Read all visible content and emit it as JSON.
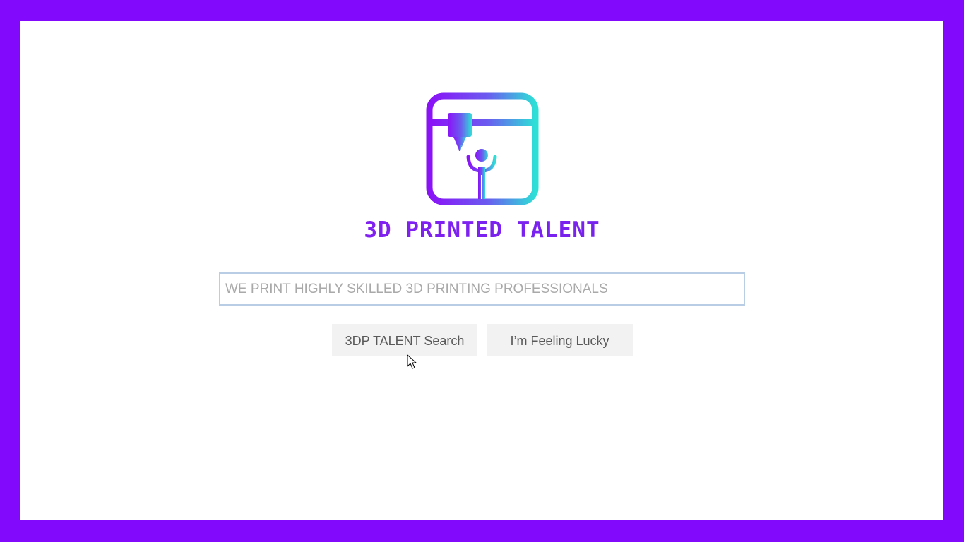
{
  "brand": {
    "name": "3D PRINTED TALENT",
    "logo_icon": "3d-printer-person-icon",
    "colors": {
      "frame": "#8209fb",
      "brand_purple": "#7a1cf0",
      "brand_teal": "#2de0d6"
    }
  },
  "search": {
    "value": "",
    "placeholder": "WE PRINT HIGHLY SKILLED 3D PRINTING PROFESSIONALS"
  },
  "buttons": {
    "search_label": "3DP TALENT Search",
    "lucky_label": "I’m Feeling Lucky"
  },
  "cursor_icon": "mouse-pointer-icon"
}
